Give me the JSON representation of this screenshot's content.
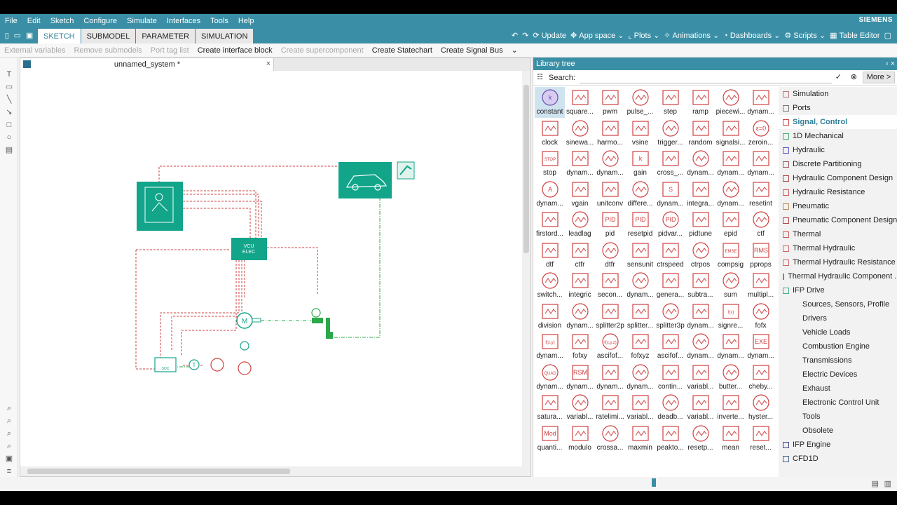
{
  "menu": [
    "File",
    "Edit",
    "Sketch",
    "Configure",
    "Simulate",
    "Interfaces",
    "Tools",
    "Help"
  ],
  "brand": "SIEMENS",
  "tabs": [
    "SKETCH",
    "SUBMODEL",
    "PARAMETER",
    "SIMULATION"
  ],
  "active_tab": "SKETCH",
  "right_tools": [
    "Update",
    "App space",
    "Plots",
    "Animations",
    "Dashboards",
    "Scripts",
    "Table Editor"
  ],
  "toolbar": {
    "external_variables": "External variables",
    "remove_submodels": "Remove submodels",
    "port_tag_list": "Port tag list",
    "create_interface_block": "Create interface block",
    "create_supercomponent": "Create supercomponent",
    "create_statechart": "Create Statechart",
    "create_signal_bus": "Create Signal Bus"
  },
  "document": {
    "title": "unnamed_system *"
  },
  "diagram": {
    "vcu_label_1": "VCU",
    "vcu_label_2": "ELEC",
    "motor_label": "M",
    "temp_label": "T",
    "soc_label": "SOC"
  },
  "library": {
    "title": "Library tree",
    "search_label": "Search:",
    "search_value": "",
    "more_button": "More >",
    "items": [
      "constant",
      "square...",
      "pwm",
      "pulse_...",
      "step",
      "ramp",
      "piecewi...",
      "dynam...",
      "clock",
      "sinewa...",
      "harmo...",
      "vsine",
      "trigger...",
      "random",
      "signalsi...",
      "zeroin...",
      "stop",
      "dynam...",
      "dynam...",
      "gain",
      "cross_...",
      "dynam...",
      "dynam...",
      "dynam...",
      "dynam...",
      "vgain",
      "unitconv",
      "differe...",
      "dynam...",
      "integra...",
      "dynam...",
      "resetint",
      "firstord...",
      "leadlag",
      "pid",
      "resetpid",
      "pidvar...",
      "pidtune",
      "epid",
      "ctf",
      "dtf",
      "ctfr",
      "dtfr",
      "sensunit",
      "ctrspeed",
      "ctrpos",
      "compsig",
      "pprops",
      "switch...",
      "integric",
      "secon...",
      "dynam...",
      "genera...",
      "subtra...",
      "sum",
      "multipl...",
      "division",
      "dynam...",
      "splitter2p",
      "splitter...",
      "splitter3p",
      "dynam...",
      "signre...",
      "fofx",
      "dynam...",
      "fofxy",
      "ascifof...",
      "fofxyz",
      "ascifof...",
      "dynam...",
      "dynam...",
      "dynam...",
      "dynam...",
      "dynam...",
      "dynam...",
      "dynam...",
      "contin...",
      "variabl...",
      "butter...",
      "cheby...",
      "satura...",
      "variabl...",
      "ratelimi...",
      "variabl...",
      "deadb...",
      "variabl...",
      "inverte...",
      "hyster...",
      "quanti...",
      "modulo",
      "crossa...",
      "maxmin",
      "peakto...",
      "resetp...",
      "mean",
      "reset..."
    ],
    "icon_texts": [
      "k",
      "",
      "",
      "",
      "",
      "",
      "",
      "",
      "",
      "",
      "",
      "",
      "",
      "",
      "",
      "ε=0",
      "STOP",
      "",
      "",
      "k",
      "",
      "",
      "",
      "",
      "A",
      "",
      "",
      "",
      "S",
      "",
      "",
      "",
      "",
      "",
      "PID",
      "PID",
      "PID",
      "",
      "",
      "",
      "",
      "",
      "",
      "",
      "",
      "",
      "EMSE",
      "RMS",
      "",
      "",
      "",
      "",
      "",
      "",
      "",
      "",
      "",
      "",
      "",
      "",
      "",
      "",
      "f(x)",
      "",
      "f(x,y)",
      "",
      "f(x,y,z)",
      "",
      "",
      "",
      "",
      "EXE",
      "QUAD",
      "RSM",
      "",
      "",
      "",
      "",
      "",
      "",
      "",
      "",
      "",
      "",
      "",
      "",
      "",
      "",
      "Mod",
      "",
      "",
      "",
      "",
      "",
      ""
    ],
    "tree": [
      {
        "label": "Simulation",
        "type": "top",
        "color": "#b77"
      },
      {
        "label": "Ports",
        "type": "top",
        "color": "#777"
      },
      {
        "label": "Signal, Control",
        "type": "selected",
        "color": "#c44"
      },
      {
        "label": "1D Mechanical",
        "type": "top",
        "color": "#4a7"
      },
      {
        "label": "Hydraulic",
        "type": "top",
        "color": "#55c"
      },
      {
        "label": "Discrete Partitioning",
        "type": "top",
        "color": "#955"
      },
      {
        "label": "Hydraulic Component Design",
        "type": "top",
        "color": "#a44"
      },
      {
        "label": "Hydraulic Resistance",
        "type": "top",
        "color": "#c55"
      },
      {
        "label": "Pneumatic",
        "type": "top",
        "color": "#b85"
      },
      {
        "label": "Pneumatic Component Design",
        "type": "top",
        "color": "#a44"
      },
      {
        "label": "Thermal",
        "type": "top",
        "color": "#c55"
      },
      {
        "label": "Thermal Hydraulic",
        "type": "top",
        "color": "#c66"
      },
      {
        "label": "Thermal Hydraulic Resistance",
        "type": "top",
        "color": "#c66"
      },
      {
        "label": "Thermal Hydraulic Component ...",
        "type": "top",
        "color": "#c66"
      },
      {
        "label": "IFP Drive",
        "type": "top",
        "color": "#4a8"
      },
      {
        "label": "Sources, Sensors, Profile",
        "type": "sub"
      },
      {
        "label": "Drivers",
        "type": "sub"
      },
      {
        "label": "Vehicle Loads",
        "type": "sub"
      },
      {
        "label": "Combustion Engine",
        "type": "sub"
      },
      {
        "label": "Transmissions",
        "type": "sub"
      },
      {
        "label": "Electric Devices",
        "type": "sub"
      },
      {
        "label": "Exhaust",
        "type": "sub"
      },
      {
        "label": "Electronic Control Unit",
        "type": "sub"
      },
      {
        "label": "Tools",
        "type": "sub"
      },
      {
        "label": "Obsolete",
        "type": "sub"
      },
      {
        "label": "IFP Engine",
        "type": "top",
        "color": "#448"
      },
      {
        "label": "CFD1D",
        "type": "top",
        "color": "#468"
      }
    ]
  }
}
